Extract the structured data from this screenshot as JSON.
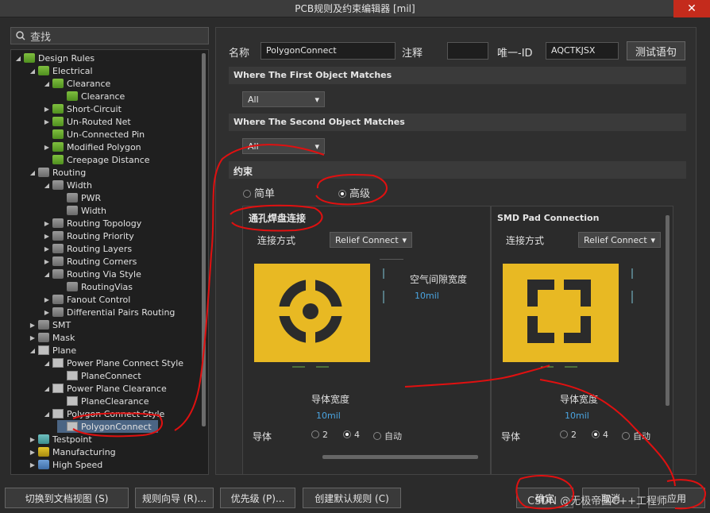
{
  "window": {
    "title": "PCB规则及约束编辑器 [mil]",
    "close": "✕"
  },
  "search": {
    "placeholder": "查找"
  },
  "tree": [
    {
      "label": "Design Rules",
      "indent": 0,
      "twisty": "◢",
      "icon": "green"
    },
    {
      "label": "Electrical",
      "indent": 1,
      "twisty": "◢",
      "icon": "green"
    },
    {
      "label": "Clearance",
      "indent": 2,
      "twisty": "◢",
      "icon": "green"
    },
    {
      "label": "Clearance",
      "indent": 3,
      "twisty": "",
      "icon": "green"
    },
    {
      "label": "Short-Circuit",
      "indent": 2,
      "twisty": "▶",
      "icon": "green"
    },
    {
      "label": "Un-Routed Net",
      "indent": 2,
      "twisty": "▶",
      "icon": "green"
    },
    {
      "label": "Un-Connected Pin",
      "indent": 2,
      "twisty": "",
      "icon": "green"
    },
    {
      "label": "Modified Polygon",
      "indent": 2,
      "twisty": "▶",
      "icon": "green"
    },
    {
      "label": "Creepage Distance",
      "indent": 2,
      "twisty": "",
      "icon": "green"
    },
    {
      "label": "Routing",
      "indent": 1,
      "twisty": "◢",
      "icon": "gray"
    },
    {
      "label": "Width",
      "indent": 2,
      "twisty": "◢",
      "icon": "gray"
    },
    {
      "label": "PWR",
      "indent": 3,
      "twisty": "",
      "icon": "gray"
    },
    {
      "label": "Width",
      "indent": 3,
      "twisty": "",
      "icon": "gray"
    },
    {
      "label": "Routing Topology",
      "indent": 2,
      "twisty": "▶",
      "icon": "gray"
    },
    {
      "label": "Routing Priority",
      "indent": 2,
      "twisty": "▶",
      "icon": "gray"
    },
    {
      "label": "Routing Layers",
      "indent": 2,
      "twisty": "▶",
      "icon": "gray"
    },
    {
      "label": "Routing Corners",
      "indent": 2,
      "twisty": "▶",
      "icon": "gray"
    },
    {
      "label": "Routing Via Style",
      "indent": 2,
      "twisty": "◢",
      "icon": "gray"
    },
    {
      "label": "RoutingVias",
      "indent": 3,
      "twisty": "",
      "icon": "gray"
    },
    {
      "label": "Fanout Control",
      "indent": 2,
      "twisty": "▶",
      "icon": "gray"
    },
    {
      "label": "Differential Pairs Routing",
      "indent": 2,
      "twisty": "▶",
      "icon": "gray"
    },
    {
      "label": "SMT",
      "indent": 1,
      "twisty": "▶",
      "icon": "gray"
    },
    {
      "label": "Mask",
      "indent": 1,
      "twisty": "▶",
      "icon": "gray"
    },
    {
      "label": "Plane",
      "indent": 1,
      "twisty": "◢",
      "icon": "pink"
    },
    {
      "label": "Power Plane Connect Style",
      "indent": 2,
      "twisty": "◢",
      "icon": "pink"
    },
    {
      "label": "PlaneConnect",
      "indent": 3,
      "twisty": "",
      "icon": "pink"
    },
    {
      "label": "Power Plane Clearance",
      "indent": 2,
      "twisty": "◢",
      "icon": "pink"
    },
    {
      "label": "PlaneClearance",
      "indent": 3,
      "twisty": "",
      "icon": "pink"
    },
    {
      "label": "Polygon Connect Style",
      "indent": 2,
      "twisty": "◢",
      "icon": "pink"
    },
    {
      "label": "PolygonConnect",
      "indent": 3,
      "twisty": "",
      "icon": "pink",
      "selected": true
    },
    {
      "label": "Testpoint",
      "indent": 1,
      "twisty": "▶",
      "icon": "teal"
    },
    {
      "label": "Manufacturing",
      "indent": 1,
      "twisty": "▶",
      "icon": "yellow"
    },
    {
      "label": "High Speed",
      "indent": 1,
      "twisty": "▶",
      "icon": "blue"
    }
  ],
  "rule": {
    "name_label": "名称",
    "name_value": "PolygonConnect",
    "comment_label": "注释",
    "comment_value": "",
    "uid_label": "唯一-ID",
    "uid_value": "AQCTKJSX",
    "test_button": "测试语句"
  },
  "first_match": {
    "header": "Where The First Object Matches",
    "value": "All"
  },
  "second_match": {
    "header": "Where The Second Object Matches",
    "value": "All"
  },
  "constraints": {
    "header": "约束",
    "simple_label": "简单",
    "advanced_label": "高级",
    "via_panel": {
      "title": "通孔焊盘连接",
      "connect_label": "连接方式",
      "connect_value": "Relief Connect",
      "air_gap_label": "空气间隙宽度",
      "air_gap_value": "10mil",
      "conductor_width_label": "导体宽度",
      "conductor_width_value": "10mil",
      "conductors_label": "导体",
      "opt2": "2",
      "opt4": "4",
      "opt_auto": "自动"
    },
    "smd_panel": {
      "title": "SMD Pad Connection",
      "connect_label": "连接方式",
      "connect_value": "Relief Connect",
      "conductor_width_label": "导体宽度",
      "conductor_width_value": "10mil",
      "conductors_label": "导体",
      "opt2": "2",
      "opt4": "4",
      "opt_auto": "自动"
    }
  },
  "footer": {
    "doc_view": "切换到文档视图 (S)",
    "rule_wizard": "规则向导 (R)...",
    "priority": "优先级 (P)...",
    "default_rules": "创建默认规则 (C)",
    "ok": "确定",
    "cancel": "取消",
    "apply": "应用",
    "watermark": "CSDN @无极帝国C++工程师"
  }
}
